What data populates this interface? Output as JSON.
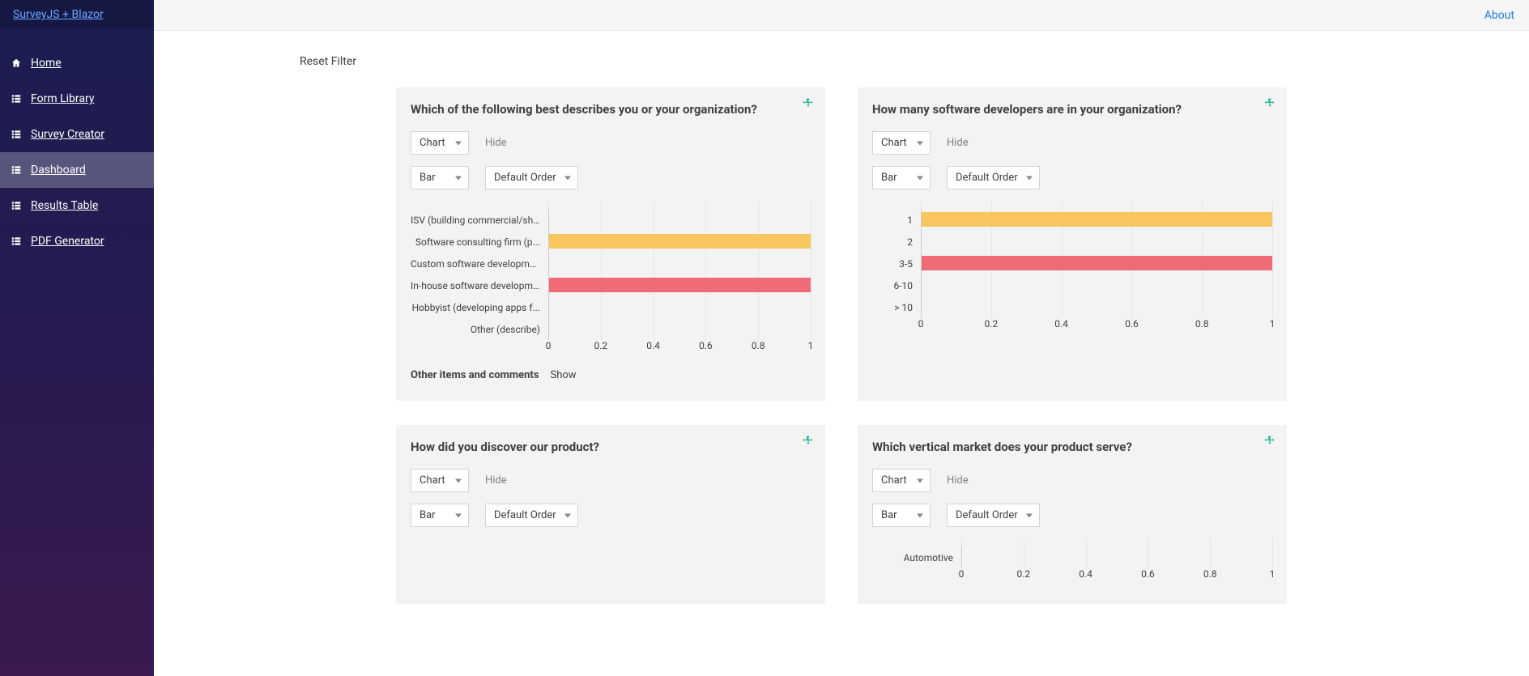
{
  "brand": "SurveyJS + Blazor",
  "topbar": {
    "about": "About"
  },
  "sidebar": {
    "items": [
      {
        "label": "Home",
        "icon": "home"
      },
      {
        "label": "Form Library",
        "icon": "list"
      },
      {
        "label": "Survey Creator",
        "icon": "list"
      },
      {
        "label": "Dashboard",
        "icon": "list",
        "active": true
      },
      {
        "label": "Results Table",
        "icon": "list"
      },
      {
        "label": "PDF Generator",
        "icon": "list"
      }
    ]
  },
  "reset_filter": "Reset Filter",
  "select_labels": {
    "chart": "Chart",
    "bar": "Bar",
    "default_order": "Default Order"
  },
  "hide": "Hide",
  "show": "Show",
  "other_items": "Other items and comments",
  "ticks": [
    "0",
    "0.2",
    "0.4",
    "0.6",
    "0.8",
    "1"
  ],
  "chart_data": [
    {
      "title": "Which of the following best describes you or your organization?",
      "type": "bar",
      "categories": [
        "ISV (building commercial/sh...",
        "Software consulting firm (p...",
        "Custom software development...",
        "In-house software development",
        "Hobbyist (developing apps f...",
        "Other (describe)"
      ],
      "values": [
        0,
        1,
        0,
        1,
        0,
        0
      ],
      "xlim": [
        0,
        1
      ],
      "show_other": true
    },
    {
      "title": "How many software developers are in your organization?",
      "type": "bar",
      "categories": [
        "1",
        "2",
        "3-5",
        "6-10",
        "> 10"
      ],
      "values": [
        1,
        0,
        1,
        0,
        0
      ],
      "xlim": [
        0,
        1
      ]
    },
    {
      "title": "How did you discover our product?",
      "type": "bar",
      "categories": [],
      "values": [],
      "xlim": [
        0,
        1
      ]
    },
    {
      "title": "Which vertical market does your product serve?",
      "type": "bar",
      "categories": [
        "Automotive"
      ],
      "values": [
        0
      ],
      "xlim": [
        0,
        1
      ]
    }
  ]
}
